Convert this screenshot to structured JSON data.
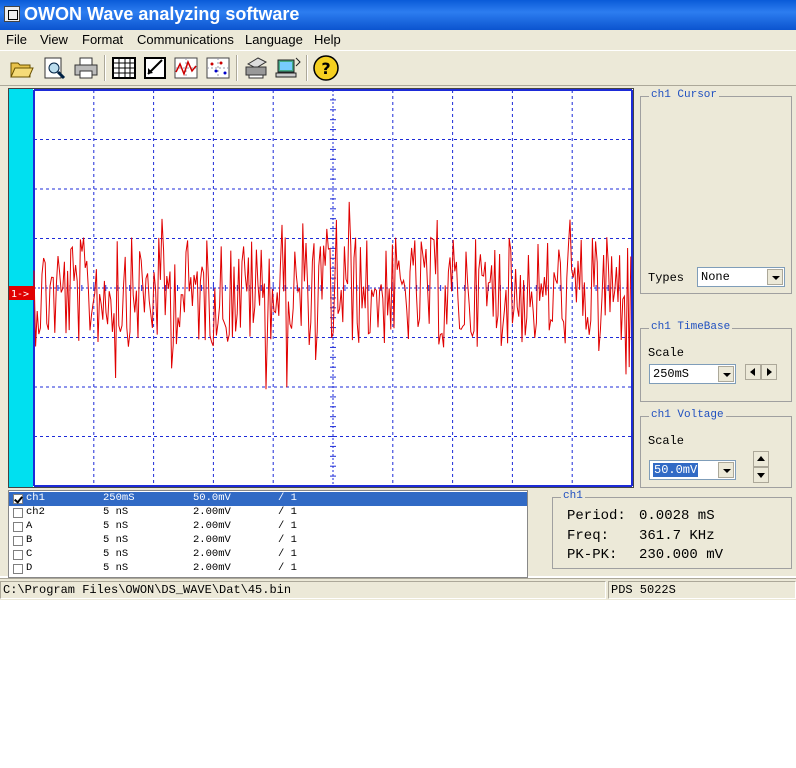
{
  "window": {
    "title": "OWON Wave analyzing software"
  },
  "menu": [
    "File",
    "View",
    "Format",
    "Communications",
    "Language",
    "Help"
  ],
  "toolbar": {
    "buttons": [
      "open-icon",
      "preview-icon",
      "print-icon",
      "table-icon",
      "edit-icon",
      "waveform-icon",
      "scatter-icon",
      "printer-setup-icon",
      "communication-icon",
      "help-icon"
    ]
  },
  "scope": {
    "marker_label": "1->",
    "colors": {
      "trace": "#e00000",
      "grid": "#1d2bd8",
      "marker_bar": "#00e0f0"
    }
  },
  "cursor_panel": {
    "title": "ch1 Cursor",
    "types_label": "Types",
    "types_value": "None"
  },
  "timebase_panel": {
    "title": "ch1 TimeBase",
    "scale_label": "Scale",
    "scale_value": "250mS"
  },
  "voltage_panel": {
    "title": "ch1 Voltage",
    "scale_label": "Scale",
    "scale_value": "50.0mV"
  },
  "channels": [
    {
      "name": "ch1",
      "time": "250mS",
      "volt": "50.0mV",
      "ratio": "/ 1",
      "checked": true,
      "selected": true
    },
    {
      "name": "ch2",
      "time": "5  nS",
      "volt": "2.00mV",
      "ratio": "/ 1",
      "checked": false,
      "selected": false
    },
    {
      "name": "A",
      "time": "5  nS",
      "volt": "2.00mV",
      "ratio": "/ 1",
      "checked": false,
      "selected": false
    },
    {
      "name": "B",
      "time": "5  nS",
      "volt": "2.00mV",
      "ratio": "/ 1",
      "checked": false,
      "selected": false
    },
    {
      "name": "C",
      "time": "5  nS",
      "volt": "2.00mV",
      "ratio": "/ 1",
      "checked": false,
      "selected": false
    },
    {
      "name": "D",
      "time": "5  nS",
      "volt": "2.00mV",
      "ratio": "/ 1",
      "checked": false,
      "selected": false
    }
  ],
  "measure": {
    "title": "ch1",
    "period_label": "Period:",
    "period_value": "0.0028 mS",
    "freq_label": "Freq:",
    "freq_value": "361.7 KHz",
    "pkpk_label": "PK-PK:",
    "pkpk_value": "230.000 mV"
  },
  "status": {
    "path": "C:\\Program Files\\OWON\\DS_WAVE\\Dat\\45.bin",
    "device": "PDS 5022S"
  }
}
